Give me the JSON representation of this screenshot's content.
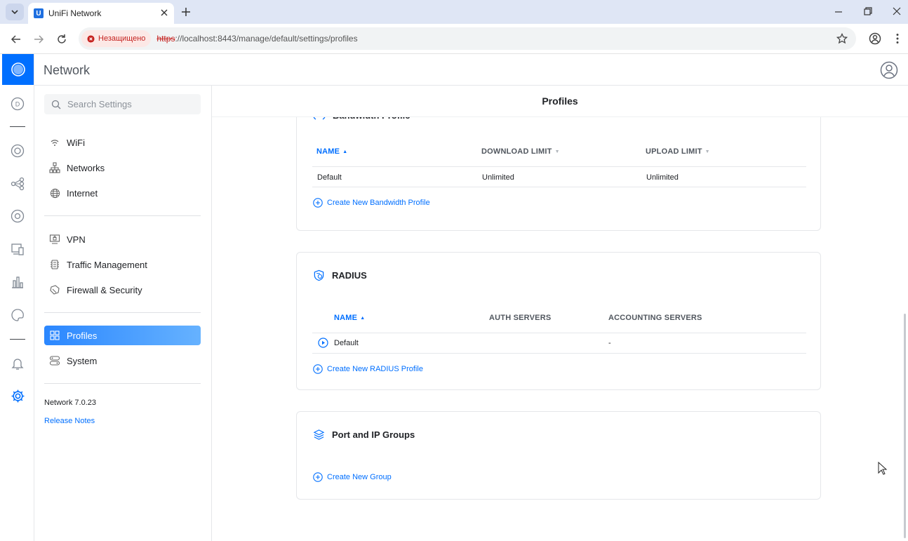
{
  "browser": {
    "tab_title": "UniFi Network",
    "insecure_label": "Незащищено",
    "url_scheme": "https",
    "url_rest": "://localhost:8443/manage/default/settings/profiles"
  },
  "app": {
    "title": "Network",
    "accent": "#006fff"
  },
  "sidebar": {
    "search_placeholder": "Search Settings",
    "groups": [
      [
        {
          "label": "WiFi",
          "icon": "wifi-icon"
        },
        {
          "label": "Networks",
          "icon": "networks-icon"
        },
        {
          "label": "Internet",
          "icon": "globe-icon"
        }
      ],
      [
        {
          "label": "VPN",
          "icon": "vpn-icon"
        },
        {
          "label": "Traffic Management",
          "icon": "traffic-icon"
        },
        {
          "label": "Firewall & Security",
          "icon": "shield-icon"
        }
      ],
      [
        {
          "label": "Profiles",
          "icon": "profiles-icon",
          "active": true
        },
        {
          "label": "System",
          "icon": "system-icon"
        }
      ]
    ],
    "version": "Network 7.0.23",
    "release_notes": "Release Notes"
  },
  "main": {
    "title": "Profiles",
    "bandwidth": {
      "title": "Bandwidth Profile",
      "columns": [
        "NAME",
        "DOWNLOAD LIMIT",
        "UPLOAD LIMIT"
      ],
      "rows": [
        [
          "Default",
          "Unlimited",
          "Unlimited"
        ]
      ],
      "create": "Create New Bandwidth Profile"
    },
    "radius": {
      "title": "RADIUS",
      "columns": [
        "NAME",
        "AUTH SERVERS",
        "ACCOUNTING SERVERS"
      ],
      "rows": [
        [
          "Default",
          "",
          "-"
        ]
      ],
      "create": "Create New RADIUS Profile"
    },
    "groups": {
      "title": "Port and IP Groups",
      "create": "Create New Group"
    }
  }
}
